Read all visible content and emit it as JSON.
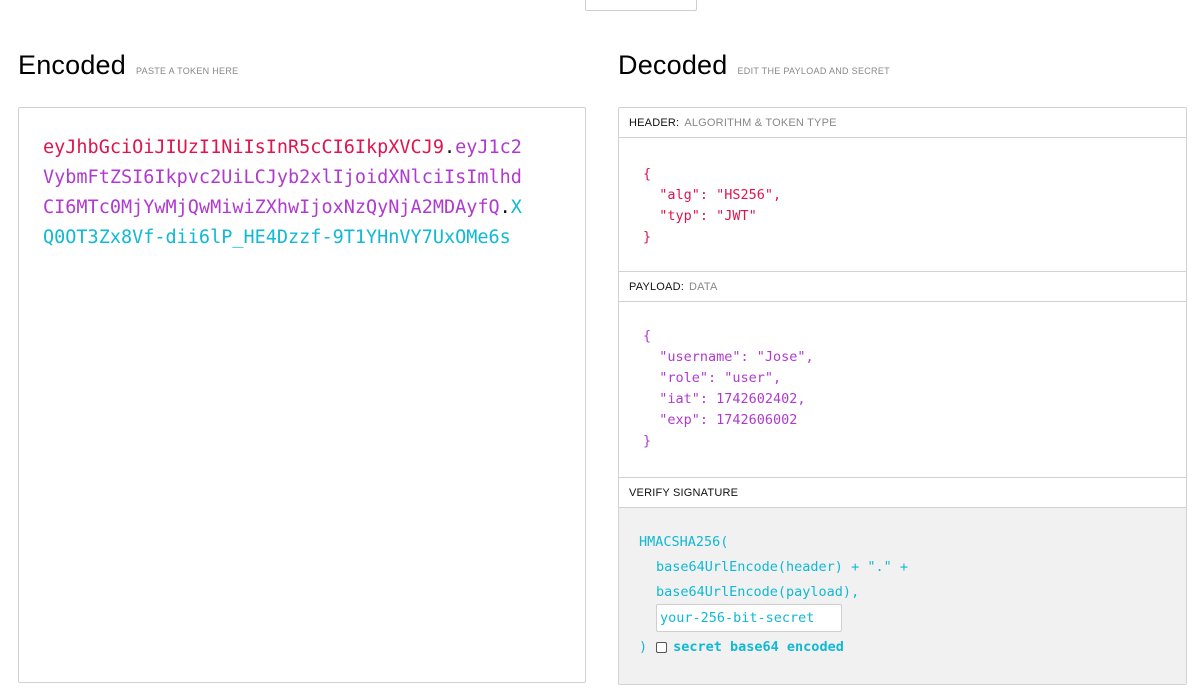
{
  "encoded": {
    "title": "Encoded",
    "hint": "PASTE A TOKEN HERE",
    "token": {
      "header": "eyJhbGciOiJIUzI1NiIsInR5cCI6IkpXVCJ9",
      "payload": "eyJ1c2VybmFtZSI6Ikpvc2UiLCJyb2xlIjoidXNlciIsImlhdCI6MTc0MjYwMjQwMiwiZXhwIjoxNzQyNjA2MDAyfQ",
      "signature": "XQ0OT3Zx8Vf-dii6lP_HE4Dzzf-9T1YHnVY7UxOMe6s",
      "dot": "."
    }
  },
  "decoded": {
    "title": "Decoded",
    "hint": "EDIT THE PAYLOAD AND SECRET",
    "header_section": {
      "label": "HEADER:",
      "sub": "ALGORITHM & TOKEN TYPE",
      "json": "{\n  \"alg\": \"HS256\",\n  \"typ\": \"JWT\"\n}"
    },
    "payload_section": {
      "label": "PAYLOAD:",
      "sub": "DATA",
      "json": "{\n  \"username\": \"Jose\",\n  \"role\": \"user\",\n  \"iat\": 1742602402,\n  \"exp\": 1742606002\n}"
    },
    "verify_section": {
      "label": "VERIFY SIGNATURE",
      "fn_open": "HMACSHA256(",
      "line1": "base64UrlEncode(header) + \".\" +",
      "line2": "base64UrlEncode(payload),",
      "secret_placeholder": "your-256-bit-secret",
      "close": ")",
      "checkbox_label": "secret base64 encoded"
    }
  },
  "colors": {
    "header": "#e0144c",
    "payload": "#b03ad0",
    "signature": "#10b9d4"
  }
}
